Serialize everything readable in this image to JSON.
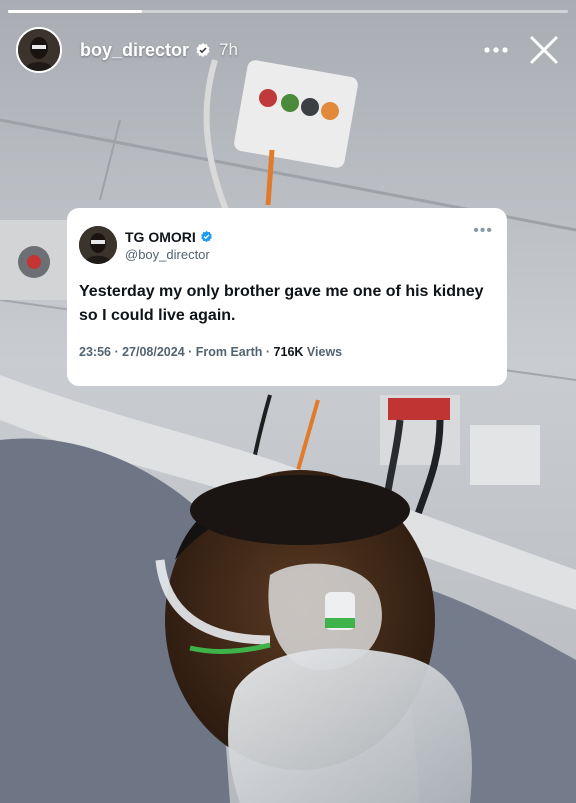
{
  "story": {
    "username": "boy_director",
    "time": "7h",
    "progress": 0.24,
    "icons": {
      "verified": "verified-badge-icon",
      "more": "more-horizontal-icon",
      "close": "close-icon"
    }
  },
  "tweet": {
    "name": "TG OMORI",
    "handle": "@boy_director",
    "text": "Yesterday my only brother gave me one of his kidney so I could live again.",
    "timestamp": "23:56 · 27/08/2024",
    "source": "From Earth",
    "views_count": "716K",
    "views_label": "Views",
    "more_glyph": "•••"
  },
  "colors": {
    "verified_blue": "#1d9bf0",
    "story_progress": "#ffffff"
  }
}
